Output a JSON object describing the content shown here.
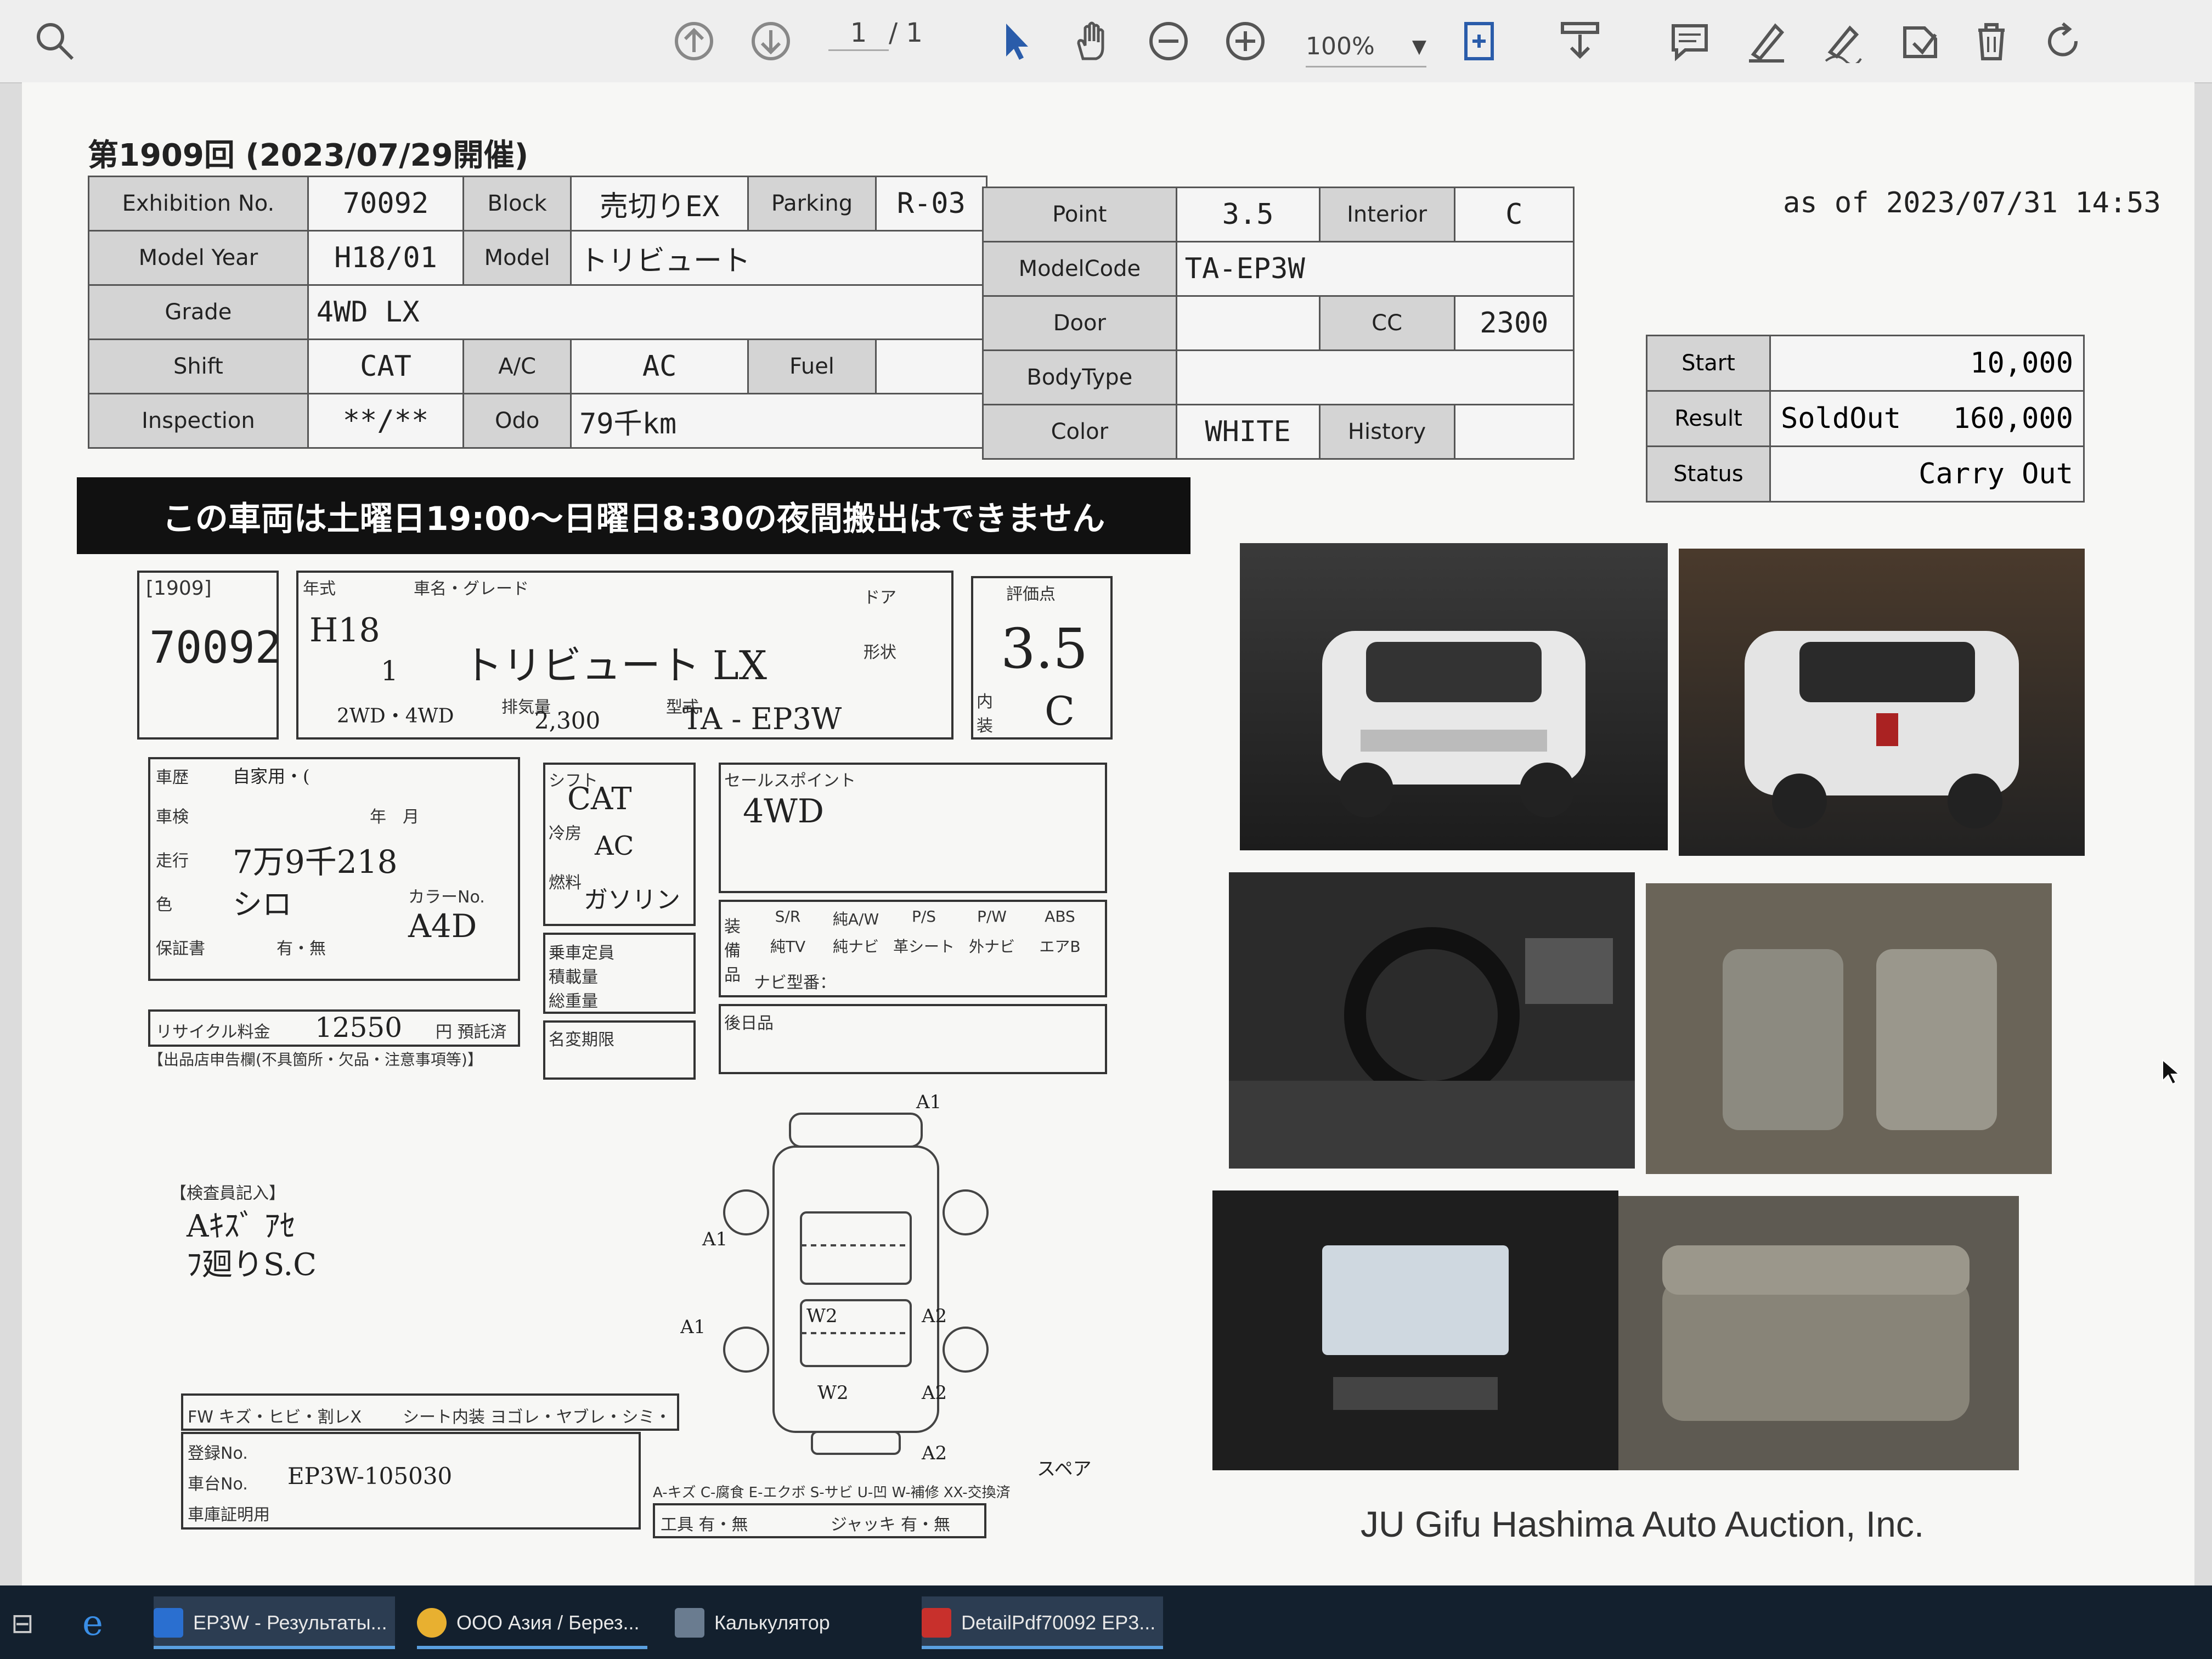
{
  "toolbar": {
    "page_current": "1",
    "page_total": "/ 1",
    "zoom": "100%"
  },
  "sheet": {
    "header": "第1909回 (2023/07/29開催)",
    "as_of": "as of 2023/07/31 14:53",
    "labels": {
      "exhibition_no": "Exhibition No.",
      "block": "Block",
      "parking": "Parking",
      "point": "Point",
      "interior": "Interior",
      "model_year": "Model Year",
      "model": "Model",
      "model_code": "ModelCode",
      "grade": "Grade",
      "door": "Door",
      "cc": "CC",
      "shift": "Shift",
      "ac": "A/C",
      "fuel": "Fuel",
      "body_type": "BodyType",
      "inspection": "Inspection",
      "odo": "Odo",
      "color": "Color",
      "history": "History"
    },
    "values": {
      "exhibition_no": "70092",
      "block": "売切りEX",
      "parking": "R-03",
      "point": "3.5",
      "interior": "C",
      "model_year": "H18/01",
      "model": "トリビュート",
      "model_code": "TA-EP3W",
      "grade": "4WD LX",
      "door": "",
      "cc": "2300",
      "shift": "CAT",
      "ac": "AC",
      "fuel": "",
      "body_type": "",
      "inspection": "**/**",
      "odo": "79千km",
      "color": "WHITE",
      "history": ""
    },
    "result": {
      "start_label": "Start",
      "start_value": "10,000",
      "result_label": "Result",
      "result_status": "SoldOut",
      "result_value": "160,000",
      "status_label": "Status",
      "status_value": "Carry Out"
    },
    "banner": "この車両は土曜日19:00～日曜日8:30の夜間搬出はできません",
    "footer": "JU Gifu Hashima Auto Auction, Inc."
  },
  "form": {
    "lot_prefix": "[1909]",
    "lot_no": "70092",
    "year_label": "年式",
    "year_value": "H18",
    "month_value": "1",
    "name_label": "車名・グレード",
    "name_value": "トリビュート LX",
    "door_label": "ドア",
    "shape_label": "形状",
    "drive_value": "2WD・4WD",
    "disp_label": "排気量",
    "disp_value": "2,300",
    "type_label": "型式",
    "type_value": "TA - EP3W",
    "score_label": "評価点",
    "score_value": "3.5",
    "interior_label": "内装",
    "interior_value": "C",
    "history_label": "車歴",
    "history_value": "自家用・(",
    "inspect_label": "車検",
    "inspect_value": "年　月",
    "mileage_label": "走行",
    "mileage_value": "7万9千218",
    "color_label": "色",
    "color_value": "シロ",
    "color_no_label": "カラーNo.",
    "color_no_value": "A4D",
    "warranty_label": "保証書",
    "warranty_value": "有・無",
    "recycle_label": "リサイクル料金",
    "recycle_value": "12550",
    "recycle_unit": "円 預託済",
    "seller_note": "【出品店申告欄(不具箇所・欠品・注意事項等)】",
    "shift_label": "シフト",
    "shift_value": "CAT",
    "ac_label": "冷房",
    "ac_value": "AC",
    "fuel_label": "燃料",
    "fuel_value": "ガソリン",
    "capacity_label": "乗車定員",
    "load_label": "積載量",
    "weight_label": "総重量",
    "expiry_label": "名変期限",
    "sales_label": "セールスポイント",
    "sales_value": "4WD",
    "equip_label": "装備品",
    "equip_items": [
      "S/R",
      "純A/W",
      "P/S",
      "P/W",
      "ABS",
      "純TV",
      "純ナビ",
      "革シート",
      "外ナビ",
      "エアB"
    ],
    "navi_label": "ナビ型番：",
    "after_label": "後日品",
    "inspector_label": "【検査員記入】",
    "inspector_note_1": "Aｷｽﾞ ｱｾ",
    "inspector_note_2": "ﾌ廻りS.C",
    "fw_value": "FW キズ・ヒビ・割レX",
    "seat_value": "シート内装 ヨゴレ・ヤブレ・シミ・焼レ・スレ",
    "reg_label": "登録No.",
    "chassis_label": "車台No.",
    "chassis_value": "EP3W-105030",
    "cert_label": "車庫証明用",
    "legend": "A-キズ C-腐食 E-エクボ S-サビ U-凹 W-補修 XX-交換済",
    "spare_label": "スペア",
    "tools_value": "工具 有・無",
    "jack_value": "ジャッキ 有・無",
    "diagram_marks": [
      "A1",
      "A1",
      "W2",
      "A2",
      "W2",
      "A2",
      "A1",
      "A2"
    ]
  },
  "taskbar": {
    "items": [
      {
        "label": "EP3W - Результаты..."
      },
      {
        "label": "ООО Азия / Берез..."
      },
      {
        "label": "Калькулятор"
      },
      {
        "label": "DetailPdf70092 EP3..."
      }
    ]
  },
  "colors": {
    "banner_bg": "#111111",
    "label_bg": "#d4d4d4",
    "taskbar_bg": "#13202e",
    "accent": "#5aa0e0"
  },
  "icons": [
    "search-icon",
    "arrow-up-icon",
    "arrow-down-icon",
    "cursor-icon",
    "hand-icon",
    "zoom-out-icon",
    "zoom-in-icon",
    "fit-page-icon",
    "download-icon",
    "comment-icon",
    "highlight-icon",
    "sign-icon",
    "stamp-icon",
    "delete-icon",
    "rotate-icon"
  ]
}
